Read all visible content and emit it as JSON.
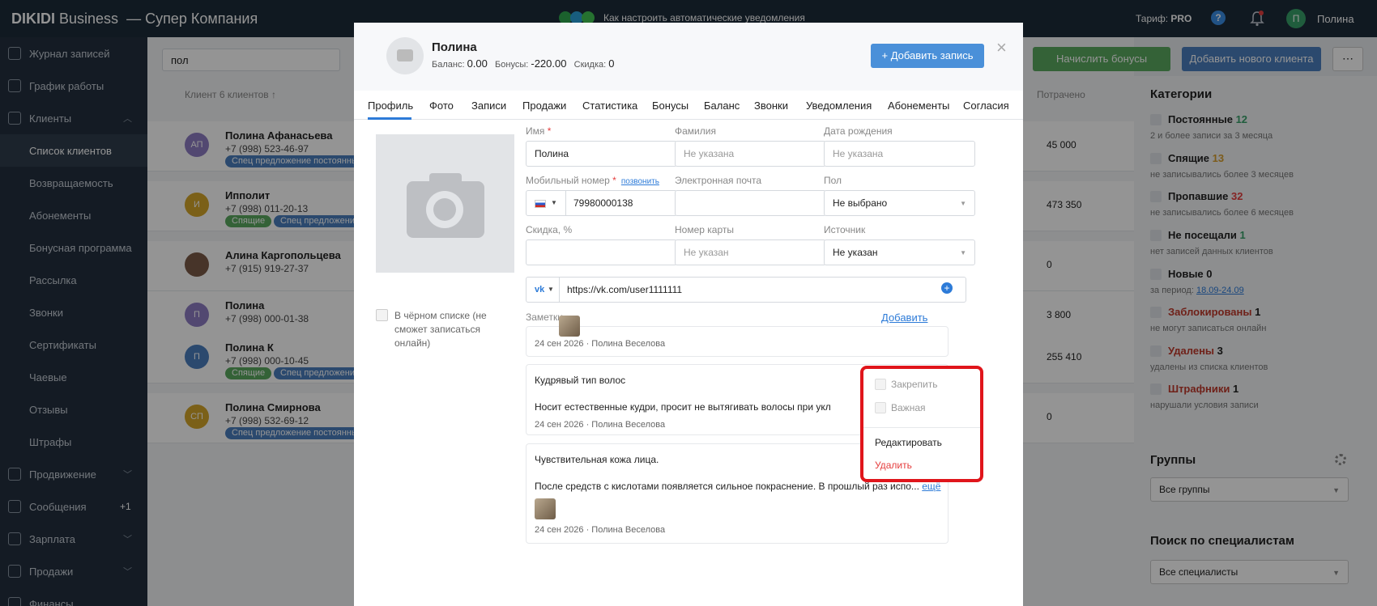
{
  "topbar": {
    "brand_bold": "DIKIDI",
    "brand_rest": " Business",
    "company": "— Супер Компания",
    "notice": "Как настроить автоматические уведомления",
    "tariff_label": "Тариф: ",
    "tariff_value": "PRO",
    "help": "?",
    "user_initial": "П",
    "user_name": "Полина"
  },
  "sidebar": {
    "items": [
      {
        "label": "Журнал записей"
      },
      {
        "label": "График работы"
      },
      {
        "label": "Клиенты"
      },
      {
        "label": "Список клиентов"
      },
      {
        "label": "Возвращаемость"
      },
      {
        "label": "Абонементы"
      },
      {
        "label": "Бонусная программа"
      },
      {
        "label": "Рассылка"
      },
      {
        "label": "Звонки"
      },
      {
        "label": "Сертификаты"
      },
      {
        "label": "Чаевые"
      },
      {
        "label": "Отзывы"
      },
      {
        "label": "Штрафы"
      },
      {
        "label": "Продвижение"
      },
      {
        "label": "Сообщения",
        "badge": "+1"
      },
      {
        "label": "Зарплата"
      },
      {
        "label": "Продажи"
      },
      {
        "label": "Финансы"
      }
    ]
  },
  "clients": {
    "search_value": "пол",
    "header": "Клиент 6 клиентов ↑",
    "spent_header": "Потрачено",
    "rows": [
      {
        "initials": "АП",
        "name": "Полина Афанасьева",
        "phone": "+7 (998) 523-46-97",
        "tag1": "Спец предложение постоянны",
        "amount": "45 000"
      },
      {
        "initials": "И",
        "name": "Ипполит",
        "phone": "+7 (998) 011-20-13",
        "tag1": "Спящие",
        "tag2": "Спец предложени",
        "amount": "473 350"
      },
      {
        "initials": "",
        "name": "Алина Каргопольцева",
        "phone": "+7 (915) 919-27-37",
        "amount": "0"
      },
      {
        "initials": "П",
        "name": "Полина",
        "phone": "+7 (998) 000-01-38",
        "amount": "3 800"
      },
      {
        "initials": "П",
        "name": "Полина К",
        "phone": "+7 (998) 000-10-45",
        "tag1": "Спящие",
        "tag2": "Спец предложени",
        "amount": "255 410"
      },
      {
        "initials": "СП",
        "name": "Полина Смирнова",
        "phone": "+7 (998) 532-69-12",
        "tag1": "Спец предложение постоянны",
        "amount": "0"
      }
    ],
    "bonus_button": "Начислить бонусы",
    "new_client_button": "Добавить нового клиента",
    "more_button": "⋯"
  },
  "right_panel": {
    "categories_title": "Категории",
    "categories": [
      {
        "name": "Постоянные",
        "count": "12",
        "desc": "2 и более записи за 3 месяца",
        "color": "#38a169"
      },
      {
        "name": "Спящие",
        "count": "13",
        "desc": "не записывались более 3 месяцев",
        "color": "#d69e2e"
      },
      {
        "name": "Пропавшие",
        "count": "32",
        "desc": "не записывались более 6 месяцев",
        "color": "#e53e3e"
      },
      {
        "name": "Не посещали",
        "count": "1",
        "desc": "нет записей данных клиентов",
        "color": "#38a169"
      },
      {
        "name": "Новые",
        "count": "0",
        "desc": "за период: ",
        "desc_link": "18.09-24.09",
        "color": "#222"
      },
      {
        "name": "Заблокированы",
        "count": "1",
        "desc": "не могут записаться онлайн",
        "color": "#222"
      },
      {
        "name": "Удалены",
        "count": "3",
        "desc": "удалены из списка клиентов",
        "color": "#222"
      },
      {
        "name": "Штрафники",
        "count": "1",
        "desc": "нарушали условия записи",
        "color": "#222"
      }
    ],
    "groups_title": "Группы",
    "groups_select": "Все группы",
    "specialists_title": "Поиск по специалистам",
    "specialists_select": "Все специалисты"
  },
  "modal": {
    "name": "Полина",
    "balance_label": "Баланс: ",
    "balance_value": "0.00",
    "bonus_label": "Бонусы: ",
    "bonus_value": "-220.00",
    "discount_label": "Скидка: ",
    "discount_value": "0",
    "add_record": "Добавить запись",
    "close": "×",
    "tabs": [
      "Профиль",
      "Фото",
      "Записи",
      "Продажи",
      "Статистика",
      "Бонусы",
      "Баланс",
      "Звонки",
      "Уведомления",
      "Абонементы",
      "Согласия"
    ],
    "blacklist": "В чёрном списке (не сможет записаться онлайн)",
    "fields": {
      "name_label": "Имя",
      "name_value": "Полина",
      "surname_label": "Фамилия",
      "surname_placeholder": "Не указана",
      "birthday_label": "Дата рождения",
      "birthday_placeholder": "Не указана",
      "phone_label": "Мобильный номер",
      "phone_call": "позвонить",
      "phone_value": "79980000138",
      "email_label": "Электронная почта",
      "gender_label": "Пол",
      "gender_value": "Не выбрано",
      "discount_label": "Скидка, %",
      "card_label": "Номер карты",
      "card_placeholder": "Не указан",
      "source_label": "Источник",
      "source_value": "Не указан",
      "required_mark": "*"
    },
    "social": {
      "network": "vk",
      "value": "https://vk.com/user1111111"
    },
    "notes_label": "Заметки",
    "notes_add": "Добавить",
    "notes": [
      {
        "meta": "24 сен 2026 · Полина Веселова"
      },
      {
        "title": "Кудрявый тип волос",
        "body": "Носит естественные кудри, просит не вытягивать волосы при укл",
        "meta": "24 сен 2026 · Полина Веселова"
      },
      {
        "title": "Чувствительная кожа лица.",
        "body": "После средств с кислотами появляется сильное покраснение. В прошлый раз испо...",
        "more": "ещё",
        "meta": "24 сен 2026 · Полина Веселова"
      }
    ]
  },
  "context_menu": {
    "pin": "Закрепить",
    "important": "Важная",
    "edit": "Редактировать",
    "delete": "Удалить"
  }
}
